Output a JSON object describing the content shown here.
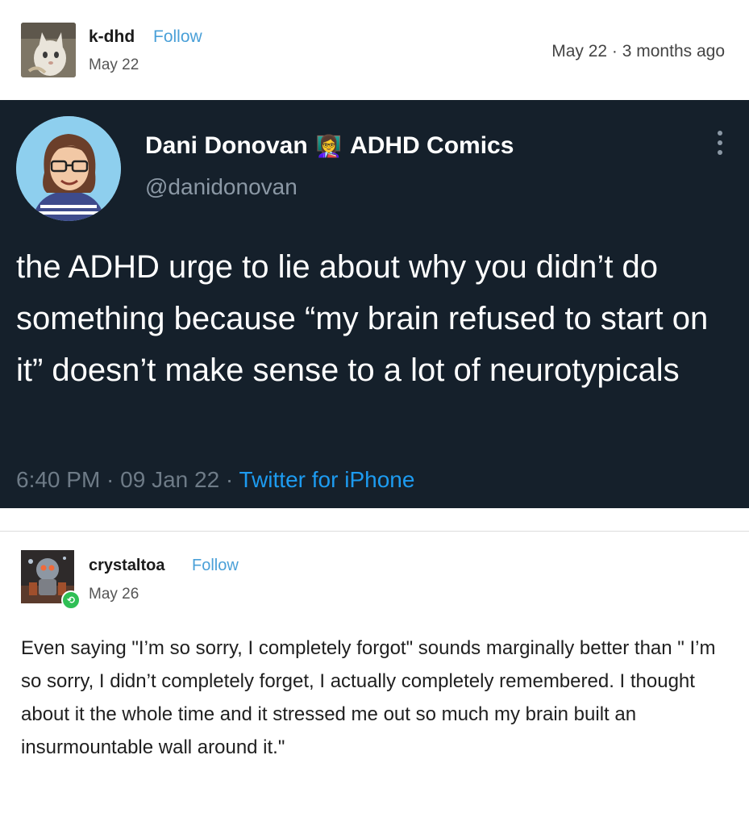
{
  "post": {
    "author": "k-dhd",
    "follow_label": "Follow",
    "date": "May 22",
    "timestamp": "May 22 · 3 months ago"
  },
  "tweet": {
    "display_name": "Dani Donovan",
    "emoji": "👩‍🏫",
    "title": "ADHD Comics",
    "handle": "@danidonovan",
    "text": "the ADHD urge to lie about why you didn’t do something because “my brain refused to start on it” doesn’t make sense to a lot of neurotypicals",
    "time": "6:40 PM · 09 Jan 22 · ",
    "source": "Twitter for iPhone"
  },
  "reblog": {
    "author": "crystaltoa",
    "follow_label": "Follow",
    "date": "May 26",
    "text": "Even saying \"I’m so sorry, I completely forgot\" sounds marginally better than \" I’m so sorry, I didn’t completely forget, I actually completely remembered. I thought about it the whole time and it stressed me out so much my brain built an insurmountable wall around it.\""
  },
  "icons": {
    "more": "more-vertical-icon",
    "reblog": "reblog-icon"
  },
  "colors": {
    "tweet_background": "#15202b",
    "follow_link": "#4aa0d8",
    "tweet_source": "#1d9bf0",
    "reblog_badge": "#2fbf55"
  }
}
